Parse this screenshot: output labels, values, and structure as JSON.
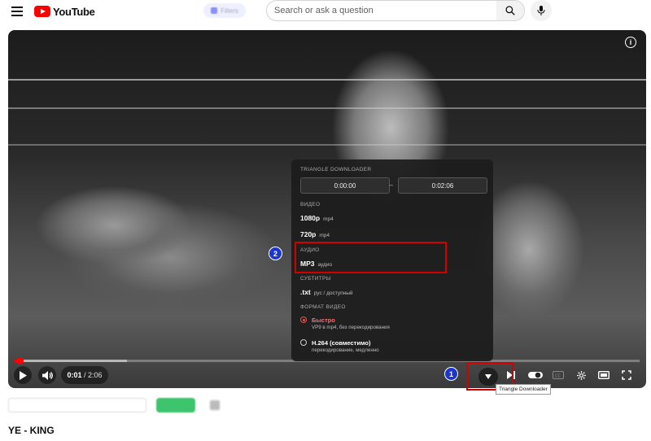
{
  "header": {
    "logo_text": "YouTube",
    "chip_label": "Filters",
    "search_placeholder": "Search or ask a question"
  },
  "player": {
    "current_time": "0:01",
    "duration": "2:06",
    "time_separator": " / ",
    "progress_fraction": 0.006,
    "buffered_fraction": 0.18,
    "info_glyph": "i"
  },
  "downloader_menu": {
    "title": "TRIANGLE DOWNLOADER",
    "start_time": "0:00:00",
    "end_time": "0:02:06",
    "range_separator": "–",
    "video_section": "ВИДЕО",
    "video_options": [
      {
        "label": "1080p",
        "sub": "mp4"
      },
      {
        "label": "720p",
        "sub": "mp4"
      }
    ],
    "audio_section": "АУДИО",
    "audio_option": {
      "label": "MP3",
      "sub": "аудио"
    },
    "subs_section": "СУБТИТРЫ",
    "subs_option": {
      "label": ".txt",
      "sub": "рус / доступный"
    },
    "format_section": "ФОРМАТ ВИДЕО",
    "formats": [
      {
        "label": "Быстро",
        "desc": "VP9 в mp4, без перекодирования",
        "selected": true
      },
      {
        "label": "H.264 (совместимо)",
        "desc": "перекодирование, медленно",
        "selected": false
      }
    ]
  },
  "annotations": {
    "step1": "1",
    "step2": "2"
  },
  "tooltip": "Triangle Downloader",
  "video_title": "YE - KING",
  "colors": {
    "brand_red": "#ff0000",
    "highlight_red": "#d40000",
    "step_blue": "#1a35d0",
    "selected_red": "#ff6b6b"
  }
}
